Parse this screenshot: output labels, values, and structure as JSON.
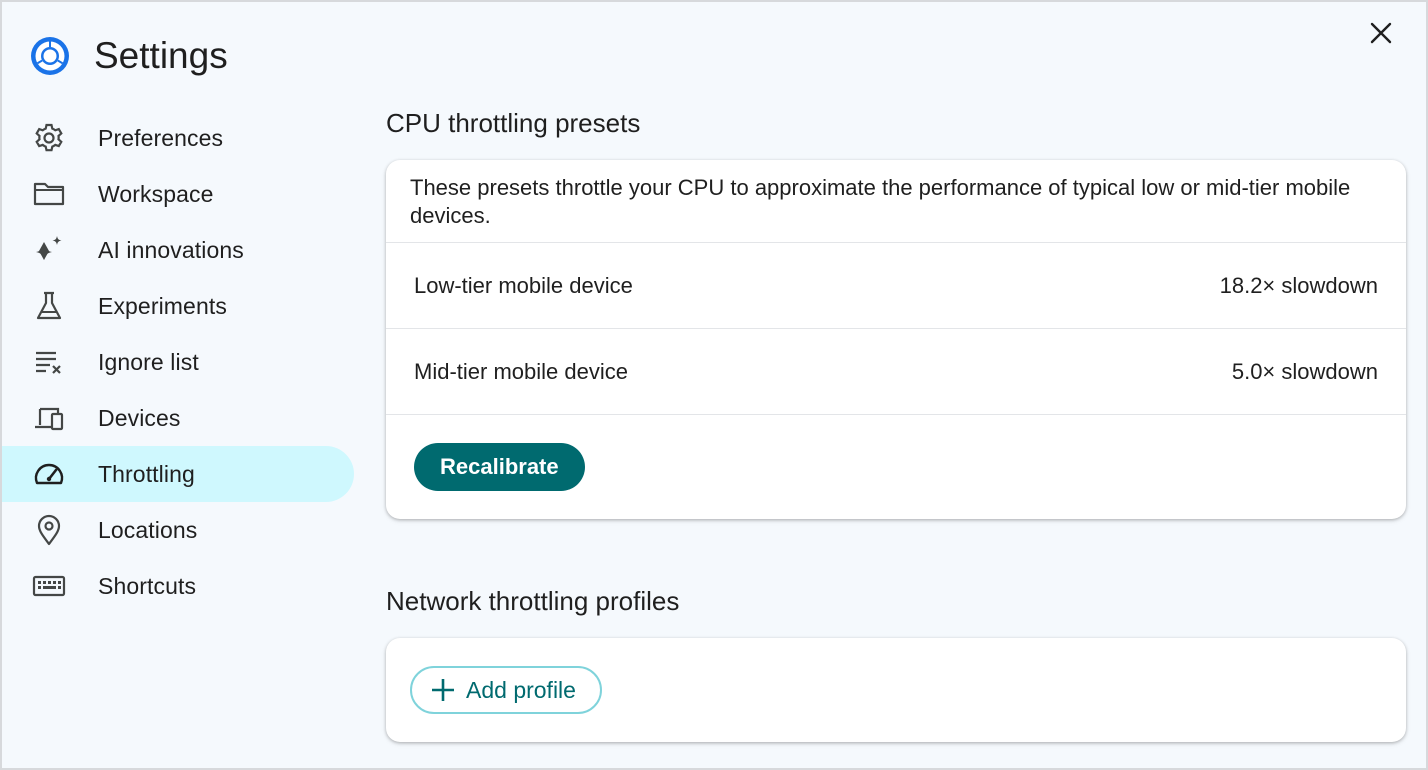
{
  "app": {
    "title": "Settings",
    "logo_icon": "chrome-logo-icon",
    "close_icon": "close-icon"
  },
  "sidebar": {
    "active_color": "#cff8fe",
    "items": [
      {
        "label": "Preferences",
        "icon": "gear-icon"
      },
      {
        "label": "Workspace",
        "icon": "folder-icon"
      },
      {
        "label": "AI innovations",
        "icon": "sparkle-icon"
      },
      {
        "label": "Experiments",
        "icon": "flask-icon"
      },
      {
        "label": "Ignore list",
        "icon": "ignore-list-icon"
      },
      {
        "label": "Devices",
        "icon": "devices-icon"
      },
      {
        "label": "Throttling",
        "icon": "speedometer-icon",
        "active": true
      },
      {
        "label": "Locations",
        "icon": "location-pin-icon"
      },
      {
        "label": "Shortcuts",
        "icon": "keyboard-icon"
      }
    ]
  },
  "cpu_section": {
    "title": "CPU throttling presets",
    "description": "These presets throttle your CPU to approximate the performance of typical low or mid-tier mobile devices.",
    "presets": [
      {
        "name": "Low-tier mobile device",
        "value": "18.2× slowdown"
      },
      {
        "name": "Mid-tier mobile device",
        "value": "5.0× slowdown"
      }
    ],
    "recalibrate_label": "Recalibrate"
  },
  "network_section": {
    "title": "Network throttling profiles",
    "add_profile_label": "Add profile"
  },
  "colors": {
    "accent": "#006a6f",
    "outline": "#7fd3db",
    "background": "#f5f9fd"
  }
}
